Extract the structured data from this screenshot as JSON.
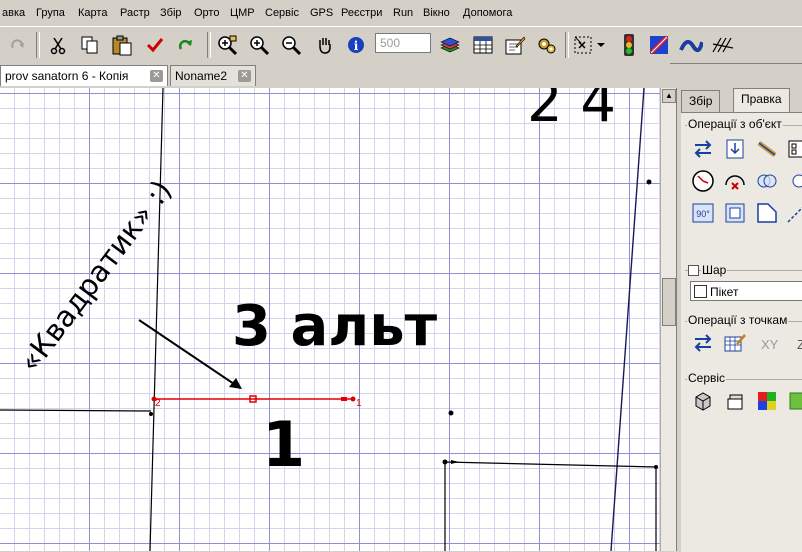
{
  "menu": [
    "авка",
    "Група",
    "Карта",
    "Растр",
    "Збір",
    "Орто",
    "ЦМР",
    "Сервіс",
    "GPS",
    "Реєстри",
    "Run",
    "Вікно",
    "Допомога"
  ],
  "toolbar": {
    "scale_value": "500"
  },
  "tabs": [
    {
      "label": "prov sanatorn 6 - Копія",
      "active": true
    },
    {
      "label": "Noname2",
      "active": false
    }
  ],
  "panel": {
    "tabs": [
      "Збір",
      "Правка"
    ],
    "group_objects": "Операції з об'єкт",
    "group_layer": "Шар",
    "layer_value": "Пікет",
    "group_points": "Операції з точкам",
    "xy_label": "XY",
    "group_service": "Сервіс"
  },
  "map": {
    "point_labels": {
      "start": "2",
      "end": "1"
    }
  },
  "annotations": {
    "numbers": "2  4",
    "alt": "3 альт",
    "one": "1",
    "quote": "«Квадратик» :)"
  },
  "colors": {
    "line": "#e00000",
    "grid_major": "#8f8fd6",
    "grid_minor": "#d4d4ef"
  }
}
